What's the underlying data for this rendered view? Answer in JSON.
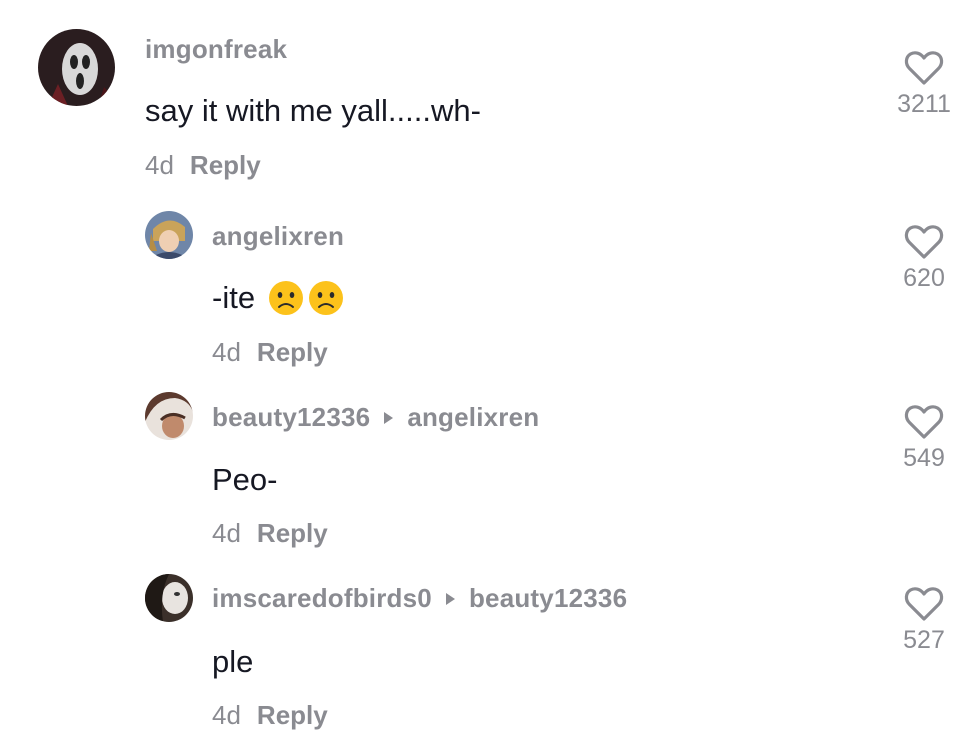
{
  "comments": [
    {
      "username": "imgonfreak",
      "reply_to": "",
      "text": "say it with me yall.....wh-",
      "age": "4d",
      "reply_label": "Reply",
      "likes": "3211",
      "avatar_icon": "ghostface-avatar"
    },
    {
      "username": "angelixren",
      "reply_to": "",
      "text": "-ite",
      "emojis": [
        "slightly-frowning-face",
        "slightly-frowning-face"
      ],
      "age": "4d",
      "reply_label": "Reply",
      "likes": "620",
      "avatar_icon": "anime-avatar"
    },
    {
      "username": "beauty12336",
      "reply_to": "angelixren",
      "text": "Peo-",
      "age": "4d",
      "reply_label": "Reply",
      "likes": "549",
      "avatar_icon": "person-avatar"
    },
    {
      "username": "imscaredofbirds0",
      "reply_to": "beauty12336",
      "text": "ple",
      "age": "4d",
      "reply_label": "Reply",
      "likes": "527",
      "avatar_icon": "person-avatar"
    }
  ],
  "colors": {
    "text": "#161823",
    "muted": "#8a8b91",
    "background": "#ffffff"
  }
}
